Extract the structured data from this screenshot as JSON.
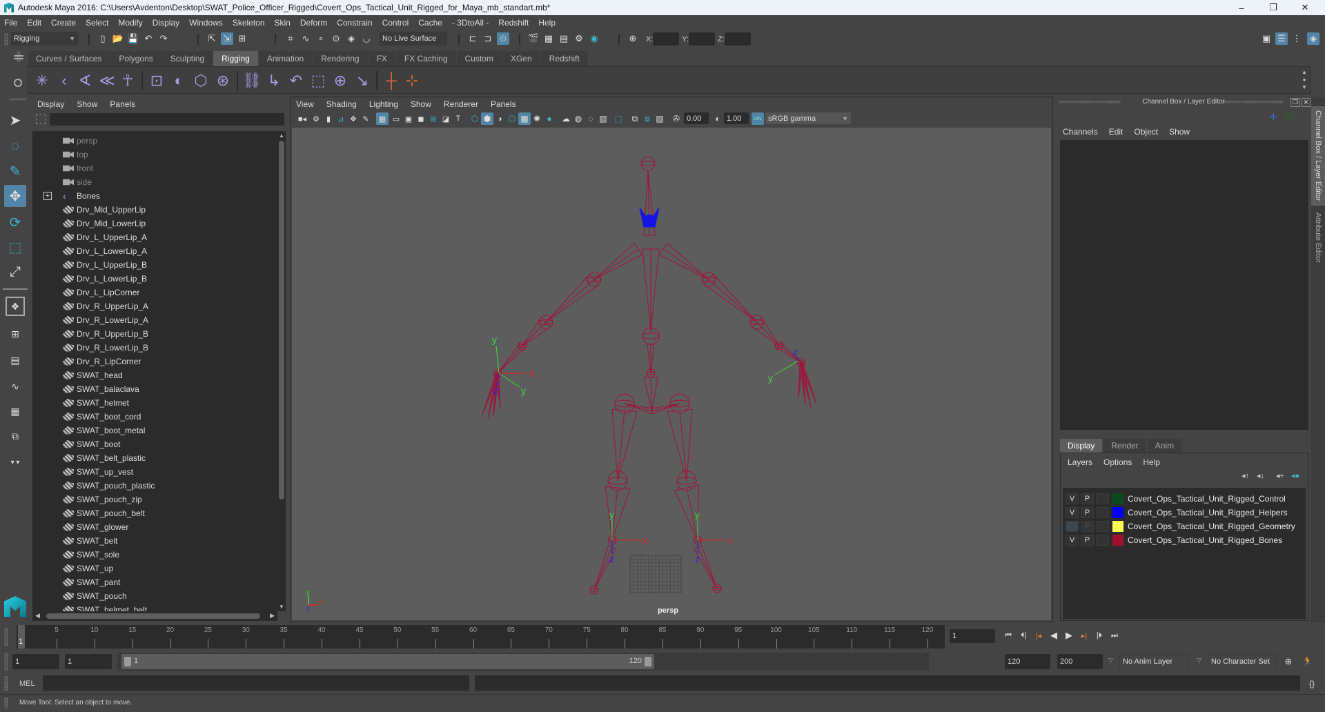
{
  "window": {
    "title": "Autodesk Maya 2016: C:\\Users\\Avdenton\\Desktop\\SWAT_Police_Officer_Rigged\\Covert_Ops_Tactical_Unit_Rigged_for_Maya_mb_standart.mb*",
    "minimize": "–",
    "restore": "❐",
    "close": "✕"
  },
  "menubar": [
    "File",
    "Edit",
    "Create",
    "Select",
    "Modify",
    "Display",
    "Windows",
    "Skeleton",
    "Skin",
    "Deform",
    "Constrain",
    "Control",
    "Cache",
    "- 3DtoAll -",
    "Redshift",
    "Help"
  ],
  "statusline": {
    "menuset": "Rigging",
    "live_surface": "No Live Surface",
    "x_label": "X:",
    "y_label": "Y:",
    "z_label": "Z:",
    "x_value": "",
    "y_value": "",
    "z_value": ""
  },
  "shelf": {
    "tabs": [
      "Curves / Surfaces",
      "Polygons",
      "Sculpting",
      "Rigging",
      "Animation",
      "Rendering",
      "FX",
      "FX Caching",
      "Custom",
      "XGen",
      "Redshift"
    ],
    "active_tab": "Rigging"
  },
  "outliner": {
    "menu": [
      "Display",
      "Show",
      "Panels"
    ],
    "search_value": "",
    "items": [
      {
        "label": "persp",
        "type": "camera"
      },
      {
        "label": "top",
        "type": "camera"
      },
      {
        "label": "front",
        "type": "camera"
      },
      {
        "label": "side",
        "type": "camera"
      },
      {
        "label": "Bones",
        "type": "joint",
        "expandable": true
      },
      {
        "label": "Drv_Mid_UpperLip",
        "type": "mesh"
      },
      {
        "label": "Drv_Mid_LowerLip",
        "type": "mesh"
      },
      {
        "label": "Drv_L_UpperLip_A",
        "type": "mesh"
      },
      {
        "label": "Drv_L_LowerLip_A",
        "type": "mesh"
      },
      {
        "label": "Drv_L_UpperLip_B",
        "type": "mesh"
      },
      {
        "label": "Drv_L_LowerLip_B",
        "type": "mesh"
      },
      {
        "label": "Drv_L_LipCorner",
        "type": "mesh"
      },
      {
        "label": "Drv_R_UpperLip_A",
        "type": "mesh"
      },
      {
        "label": "Drv_R_LowerLip_A",
        "type": "mesh"
      },
      {
        "label": "Drv_R_UpperLip_B",
        "type": "mesh"
      },
      {
        "label": "Drv_R_LowerLip_B",
        "type": "mesh"
      },
      {
        "label": "Drv_R_LipCorner",
        "type": "mesh"
      },
      {
        "label": "SWAT_head",
        "type": "mesh"
      },
      {
        "label": "SWAT_balaclava",
        "type": "mesh"
      },
      {
        "label": "SWAT_helmet",
        "type": "mesh"
      },
      {
        "label": "SWAT_boot_cord",
        "type": "mesh"
      },
      {
        "label": "SWAT_boot_metal",
        "type": "mesh"
      },
      {
        "label": "SWAT_boot",
        "type": "mesh"
      },
      {
        "label": "SWAT_belt_plastic",
        "type": "mesh"
      },
      {
        "label": "SWAT_up_vest",
        "type": "mesh"
      },
      {
        "label": "SWAT_pouch_plastic",
        "type": "mesh"
      },
      {
        "label": "SWAT_pouch_zip",
        "type": "mesh"
      },
      {
        "label": "SWAT_pouch_belt",
        "type": "mesh"
      },
      {
        "label": "SWAT_glower",
        "type": "mesh"
      },
      {
        "label": "SWAT_belt",
        "type": "mesh"
      },
      {
        "label": "SWAT_sole",
        "type": "mesh"
      },
      {
        "label": "SWAT_up",
        "type": "mesh"
      },
      {
        "label": "SWAT_pant",
        "type": "mesh"
      },
      {
        "label": "SWAT_pouch",
        "type": "mesh"
      },
      {
        "label": "SWAT_helmet_belt",
        "type": "mesh"
      }
    ]
  },
  "viewport": {
    "menu": [
      "View",
      "Shading",
      "Lighting",
      "Show",
      "Renderer",
      "Panels"
    ],
    "exposure": "0.00",
    "gamma": "1.00",
    "color_mgmt": "ON",
    "color_space": "sRGB gamma",
    "camera_label": "persp",
    "axis_labels": {
      "x": "x",
      "y": "y",
      "z": "z"
    },
    "colors": {
      "bones": "#a0143c",
      "helpers": "#1414e6",
      "background": "#5d5d5d"
    }
  },
  "channel_box": {
    "title": "Channel Box / Layer Editor",
    "menu": [
      "Channels",
      "Edit",
      "Object",
      "Show"
    ]
  },
  "layer_editor": {
    "tabs": [
      "Display",
      "Render",
      "Anim"
    ],
    "active_tab": "Display",
    "menu": [
      "Layers",
      "Options",
      "Help"
    ],
    "layers": [
      {
        "v": "V",
        "p": "P",
        "color": "#0a4a1e",
        "name": "Covert_Ops_Tactical_Unit_Rigged_Control",
        "visible": true
      },
      {
        "v": "V",
        "p": "P",
        "color": "#0000ff",
        "name": "Covert_Ops_Tactical_Unit_Rigged_Helpers",
        "visible": true
      },
      {
        "v": "",
        "p": "P",
        "color": "#ffff55",
        "name": "Covert_Ops_Tactical_Unit_Rigged_Geometry",
        "visible": false
      },
      {
        "v": "V",
        "p": "P",
        "color": "#a0102e",
        "name": "Covert_Ops_Tactical_Unit_Rigged_Bones",
        "visible": true
      }
    ]
  },
  "side_tabs": [
    "Channel Box / Layer Editor",
    "Attribute Editor"
  ],
  "timeline": {
    "ticks": [
      5,
      10,
      15,
      20,
      25,
      30,
      35,
      40,
      45,
      50,
      55,
      60,
      65,
      70,
      75,
      80,
      85,
      90,
      95,
      100,
      105,
      110,
      115,
      120
    ],
    "current_frame_marker": "1",
    "current_frame": "1"
  },
  "range": {
    "start": "1",
    "playback_start": "1",
    "slider_start": "1",
    "slider_end": "120",
    "playback_end": "120",
    "end": "200",
    "anim_layer": "No Anim Layer",
    "character_set": "No Character Set"
  },
  "command_line": {
    "label": "MEL",
    "value": ""
  },
  "help_line": "Move Tool: Select an object to move."
}
